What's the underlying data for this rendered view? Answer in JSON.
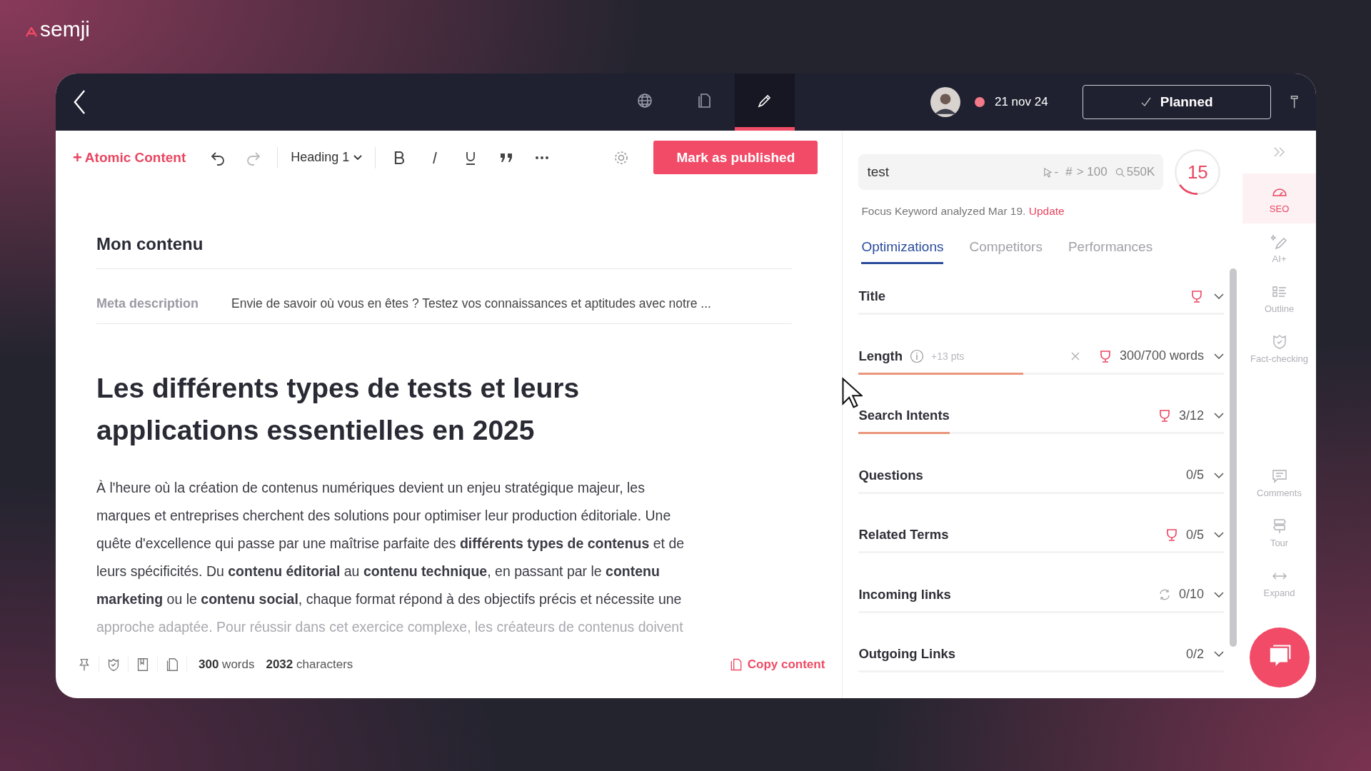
{
  "brand": {
    "name": "semji"
  },
  "topbar": {
    "views": [
      {
        "kind": "globe",
        "selected": false
      },
      {
        "kind": "document",
        "selected": false
      },
      {
        "kind": "pencil",
        "selected": true
      }
    ],
    "date": "21 nov 24",
    "status_button": "Planned"
  },
  "toolbar": {
    "add_sign": "+",
    "add_label": "Atomic Content",
    "block_type": "Heading 1",
    "publish_button": "Mark as published"
  },
  "document": {
    "title": "Mon contenu",
    "meta_label": "Meta description",
    "meta_value": "Envie de savoir où vous en êtes ? Testez vos connaissances et aptitudes avec notre ...",
    "heading": "Les différents types de tests et leurs applications essentielles en 2025",
    "paragraph_lines": [
      "À l'heure où la création de contenus numériques devient un enjeu stratégique majeur, les",
      "marques et entreprises cherchent des solutions pour optimiser leur production éditoriale. Une",
      "quête d'excellence qui passe par une maîtrise parfaite des **différents types de contenus** et de",
      "leurs spécificités. Du **contenu éditorial** au **contenu technique**, en passant par le **contenu**",
      "**marketing** ou le **contenu social**, chaque format répond à des objectifs précis et nécessite une"
    ],
    "faded_line": "approche adaptée. Pour réussir dans cet exercice complexe, les créateurs de contenus doivent"
  },
  "footer": {
    "words": "300",
    "words_label": "words",
    "chars": "2032",
    "chars_label": "characters",
    "copy": "Copy content"
  },
  "seo": {
    "keyword": "test",
    "clicks": "-",
    "rank_sign": "#",
    "rank": "> 100",
    "volume": "550K",
    "score": "15",
    "level": 0.15,
    "analyzed": "Focus Keyword analyzed Mar 19.",
    "update": "Update",
    "tabs": [
      {
        "label": "Optimizations",
        "selected": true
      },
      {
        "label": "Competitors",
        "selected": false
      },
      {
        "label": "Performances",
        "selected": false
      }
    ],
    "items": [
      {
        "label": "Title",
        "kind": "plain",
        "trophy": true
      },
      {
        "label": "Length",
        "kind": "length",
        "hint": "+13 pts",
        "trophy": true,
        "value": "300/700 words",
        "level": 0.45
      },
      {
        "label": "Search Intents",
        "kind": "plain",
        "trophy": true,
        "value": "3/12",
        "level": 0.25
      },
      {
        "label": "Questions",
        "kind": "plain",
        "trophy": false,
        "value": "0/5"
      },
      {
        "label": "Related Terms",
        "kind": "plain",
        "trophy": true,
        "value": "0/5"
      },
      {
        "label": "Incoming links",
        "kind": "sync",
        "trophy": false,
        "value": "0/10"
      },
      {
        "label": "Outgoing Links",
        "kind": "plain",
        "trophy": false,
        "value": "0/2"
      }
    ]
  },
  "rail": [
    {
      "label": "SEO",
      "kind": "gauge",
      "selected": true
    },
    {
      "label": "AI+",
      "kind": "wand",
      "selected": false
    },
    {
      "label": "Outline",
      "kind": "outline",
      "selected": false
    },
    {
      "label": "Fact-checking",
      "kind": "shield",
      "selected": false
    },
    {
      "label": "Comments",
      "kind": "comment",
      "selected": false
    },
    {
      "label": "Tour",
      "kind": "signpost",
      "selected": false
    },
    {
      "label": "Expand",
      "kind": "expand",
      "selected": false
    }
  ]
}
